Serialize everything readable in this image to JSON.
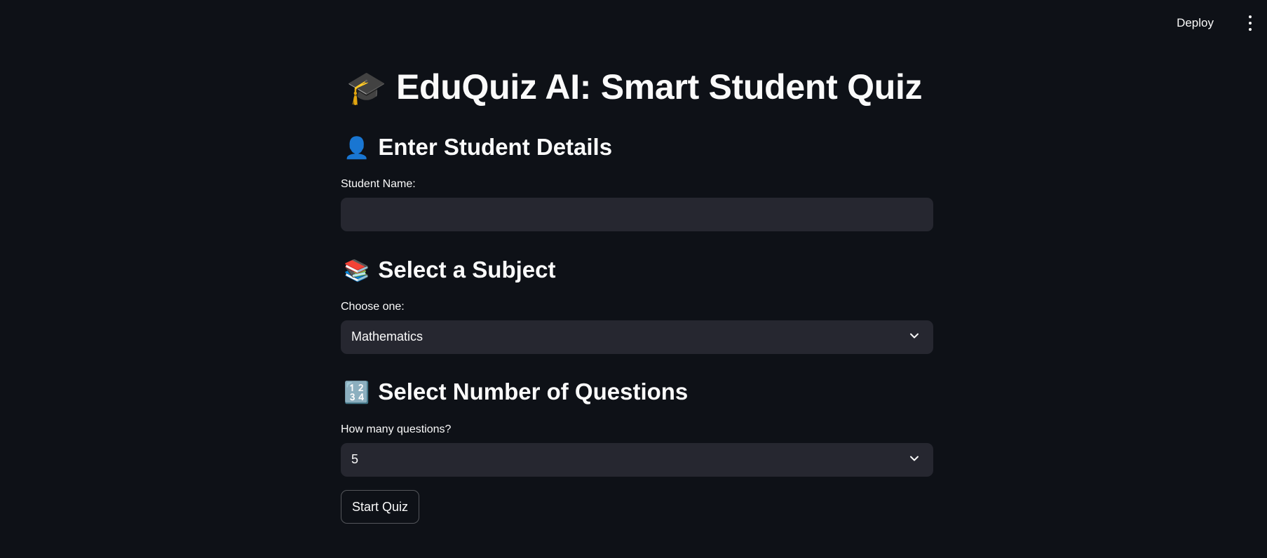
{
  "header": {
    "deploy_label": "Deploy",
    "menu_icon": "kebab-menu-icon"
  },
  "title": {
    "emoji": "🎓",
    "text": "EduQuiz AI: Smart Student Quiz"
  },
  "student_section": {
    "emoji": "👤",
    "heading": "Enter Student Details",
    "name_label": "Student Name:",
    "name_value": ""
  },
  "subject_section": {
    "emoji": "📚",
    "heading": "Select a Subject",
    "select_label": "Choose one:",
    "selected": "Mathematics"
  },
  "questions_section": {
    "emoji": "🔢",
    "heading": "Select Number of Questions",
    "select_label": "How many questions?",
    "selected": "5"
  },
  "start_button": {
    "label": "Start Quiz"
  },
  "colors": {
    "background": "#0e1117",
    "input_background": "#262730",
    "text": "#fafafa"
  }
}
